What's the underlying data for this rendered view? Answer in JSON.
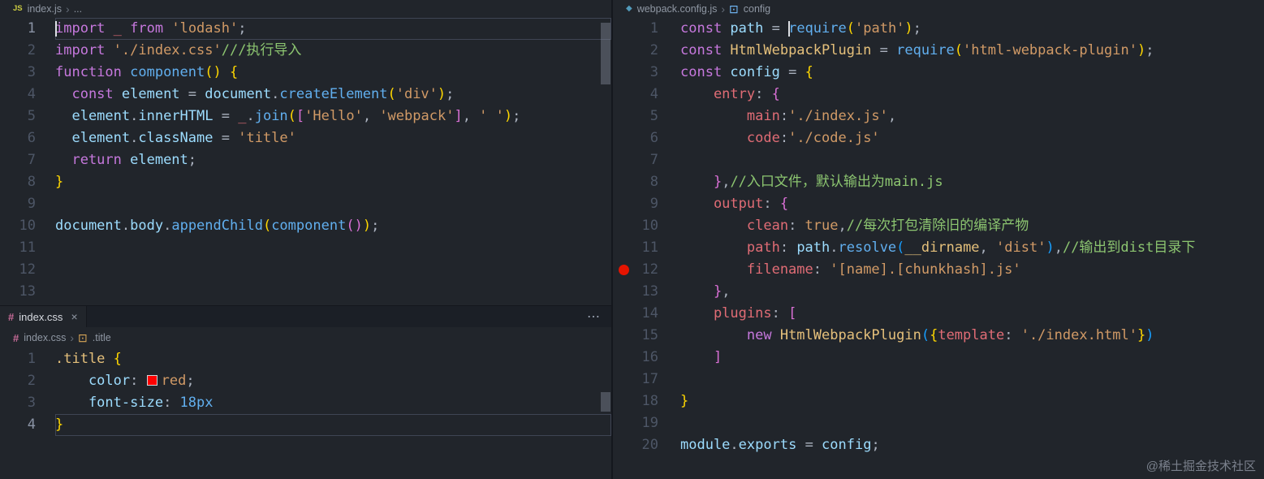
{
  "watermark": "@稀土掘金技术社区",
  "chevron": "›",
  "panes": {
    "left_top": {
      "breadcrumb": {
        "icon": "JS",
        "file": "index.js",
        "symbol": "..."
      },
      "current_line": 1,
      "caret": {
        "line": 1,
        "col": 0
      },
      "lines": [
        [
          [
            "import",
            "kw"
          ],
          [
            " _",
            "rd"
          ],
          [
            " ",
            "pn"
          ],
          [
            "from",
            "kw"
          ],
          [
            " 'lodash'",
            "str"
          ],
          [
            ";",
            "pn"
          ]
        ],
        [
          [
            "import",
            "kw"
          ],
          [
            " './index.css'",
            "str"
          ],
          [
            "///执行导入",
            "com"
          ]
        ],
        [
          [
            "function",
            "kw"
          ],
          [
            " component",
            "fn"
          ],
          [
            "(",
            "b1"
          ],
          [
            ")",
            "b1"
          ],
          [
            " {",
            "b1"
          ]
        ],
        [
          [
            "  const",
            "kw"
          ],
          [
            " element",
            "vr"
          ],
          [
            " = ",
            "pn"
          ],
          [
            "document",
            "vr"
          ],
          [
            ".",
            "pn"
          ],
          [
            "createElement",
            "fn"
          ],
          [
            "(",
            "b1"
          ],
          [
            "'div'",
            "str"
          ],
          [
            ")",
            "b1"
          ],
          [
            ";",
            "pn"
          ]
        ],
        [
          [
            "  element",
            "vr"
          ],
          [
            ".",
            "pn"
          ],
          [
            "innerHTML",
            "vr"
          ],
          [
            " = ",
            "pn"
          ],
          [
            "_",
            "rd"
          ],
          [
            ".",
            "pn"
          ],
          [
            "join",
            "fn"
          ],
          [
            "(",
            "b1"
          ],
          [
            "[",
            "b2"
          ],
          [
            "'Hello'",
            "str"
          ],
          [
            ", ",
            "pn"
          ],
          [
            "'webpack'",
            "str"
          ],
          [
            "]",
            "b2"
          ],
          [
            ", ",
            "pn"
          ],
          [
            "' '",
            "str"
          ],
          [
            ")",
            "b1"
          ],
          [
            ";",
            "pn"
          ]
        ],
        [
          [
            "  element",
            "vr"
          ],
          [
            ".",
            "pn"
          ],
          [
            "className",
            "vr"
          ],
          [
            " = ",
            "pn"
          ],
          [
            "'title'",
            "str"
          ]
        ],
        [
          [
            "  return",
            "kw"
          ],
          [
            " element",
            "vr"
          ],
          [
            ";",
            "pn"
          ]
        ],
        [
          [
            "}",
            "b1"
          ]
        ],
        [],
        [
          [
            "document",
            "vr"
          ],
          [
            ".",
            "pn"
          ],
          [
            "body",
            "vr"
          ],
          [
            ".",
            "pn"
          ],
          [
            "appendChild",
            "fn"
          ],
          [
            "(",
            "b1"
          ],
          [
            "component",
            "fn"
          ],
          [
            "(",
            "b2"
          ],
          [
            ")",
            "b2"
          ],
          [
            ")",
            "b1"
          ],
          [
            ";",
            "pn"
          ]
        ],
        [],
        [],
        []
      ]
    },
    "left_bottom": {
      "tab": {
        "icon": "#",
        "label": "index.css",
        "close": "×"
      },
      "actions": "⋯",
      "breadcrumb": {
        "icon": "#",
        "file": "index.css",
        "symbol_icon": "⊡",
        "symbol": ".title"
      },
      "current_line": 4,
      "lines": [
        [
          [
            ".title",
            "cls"
          ],
          [
            " ",
            "pn"
          ],
          [
            "{",
            "b1"
          ]
        ],
        [
          [
            "    color",
            "prop"
          ],
          [
            ": ",
            "pn"
          ],
          [
            "#ff0000",
            "swatch"
          ],
          [
            "red",
            "str"
          ],
          [
            ";",
            "pn"
          ]
        ],
        [
          [
            "    font-size",
            "prop"
          ],
          [
            ": ",
            "pn"
          ],
          [
            "18px",
            "num"
          ]
        ],
        [
          [
            "}",
            "b1"
          ]
        ]
      ]
    },
    "right": {
      "breadcrumb": {
        "icon": "◆",
        "file": "webpack.config.js",
        "symbol_icon": "⊡",
        "symbol": "config"
      },
      "breakpoint_line": 12,
      "caret": {
        "line": 1,
        "col": 13
      },
      "lines": [
        [
          [
            "const",
            "kw"
          ],
          [
            " path",
            "vr"
          ],
          [
            " = ",
            "pn"
          ],
          [
            "require",
            "fn"
          ],
          [
            "(",
            "b1"
          ],
          [
            "'path'",
            "str"
          ],
          [
            ")",
            "b1"
          ],
          [
            ";",
            "pn"
          ]
        ],
        [
          [
            "const",
            "kw"
          ],
          [
            " HtmlWebpackPlugin",
            "cls"
          ],
          [
            " = ",
            "pn"
          ],
          [
            "require",
            "fn"
          ],
          [
            "(",
            "b1"
          ],
          [
            "'html-webpack-plugin'",
            "str"
          ],
          [
            ")",
            "b1"
          ],
          [
            ";",
            "pn"
          ]
        ],
        [
          [
            "const",
            "kw"
          ],
          [
            " config",
            "vr"
          ],
          [
            " = ",
            "pn"
          ],
          [
            "{",
            "b1"
          ]
        ],
        [
          [
            "    entry",
            "rd"
          ],
          [
            ": ",
            "pn"
          ],
          [
            "{",
            "b2"
          ]
        ],
        [
          [
            "        main",
            "rd"
          ],
          [
            ":",
            "pn"
          ],
          [
            "'./index.js'",
            "str"
          ],
          [
            ",",
            "pn"
          ]
        ],
        [
          [
            "        code",
            "rd"
          ],
          [
            ":",
            "pn"
          ],
          [
            "'./code.js'",
            "str"
          ]
        ],
        [],
        [
          [
            "    }",
            "b2"
          ],
          [
            ",",
            "pn"
          ],
          [
            "//入口文件，默认输出为main.js",
            "com"
          ]
        ],
        [
          [
            "    output",
            "rd"
          ],
          [
            ": ",
            "pn"
          ],
          [
            "{",
            "b2"
          ]
        ],
        [
          [
            "        clean",
            "rd"
          ],
          [
            ": ",
            "pn"
          ],
          [
            "true",
            "cst"
          ],
          [
            ",",
            "pn"
          ],
          [
            "//每次打包清除旧的编译产物",
            "com"
          ]
        ],
        [
          [
            "        path",
            "rd"
          ],
          [
            ": ",
            "pn"
          ],
          [
            "path",
            "vr"
          ],
          [
            ".",
            "pn"
          ],
          [
            "resolve",
            "fn"
          ],
          [
            "(",
            "b3"
          ],
          [
            "__dirname",
            "cls"
          ],
          [
            ", ",
            "pn"
          ],
          [
            "'dist'",
            "str"
          ],
          [
            ")",
            "b3"
          ],
          [
            ",",
            "pn"
          ],
          [
            "//输出到dist目录下",
            "com"
          ]
        ],
        [
          [
            "        filename",
            "rd"
          ],
          [
            ": ",
            "pn"
          ],
          [
            "'[name].[chunkhash].js'",
            "str"
          ]
        ],
        [
          [
            "    }",
            "b2"
          ],
          [
            ",",
            "pn"
          ]
        ],
        [
          [
            "    plugins",
            "rd"
          ],
          [
            ": ",
            "pn"
          ],
          [
            "[",
            "b2"
          ]
        ],
        [
          [
            "        new",
            "kw"
          ],
          [
            " HtmlWebpackPlugin",
            "cls"
          ],
          [
            "(",
            "b3"
          ],
          [
            "{",
            "b1"
          ],
          [
            "template",
            "rd"
          ],
          [
            ": ",
            "pn"
          ],
          [
            "'./index.html'",
            "str"
          ],
          [
            "}",
            "b1"
          ],
          [
            ")",
            "b3"
          ]
        ],
        [
          [
            "    ]",
            "b2"
          ]
        ],
        [],
        [
          [
            "}",
            "b1"
          ]
        ],
        [],
        [
          [
            "module",
            "vr"
          ],
          [
            ".",
            "pn"
          ],
          [
            "exports",
            "vr"
          ],
          [
            " = ",
            "pn"
          ],
          [
            "config",
            "vr"
          ],
          [
            ";",
            "pn"
          ]
        ]
      ]
    }
  }
}
